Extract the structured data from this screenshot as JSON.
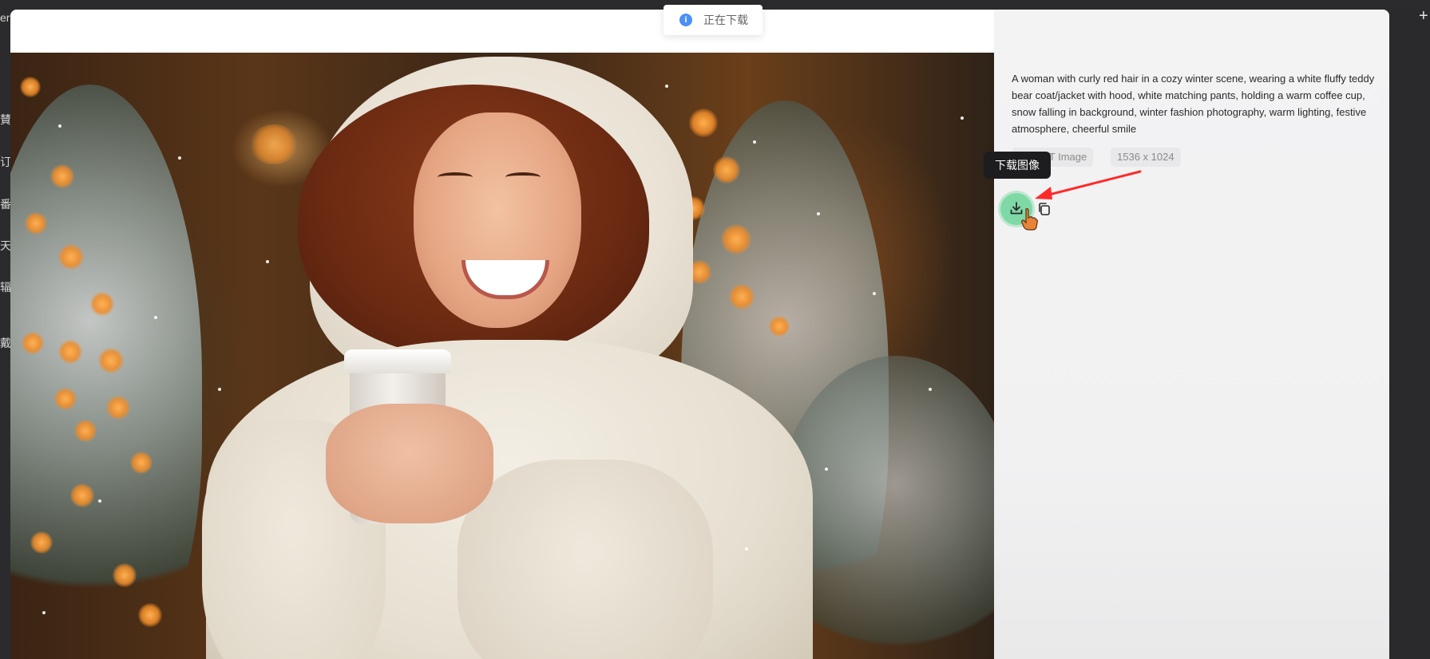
{
  "app": {
    "left_menu_fragments": [
      "er",
      "賛",
      "订",
      "番",
      "天",
      "辐",
      "戴"
    ]
  },
  "toast": {
    "message": "正在下载",
    "icon": "info-icon"
  },
  "image": {
    "alt_icon": "generated-image"
  },
  "info_panel": {
    "prompt": "A woman with curly red hair in a cozy winter scene, wearing a white fluffy teddy bear coat/jacket with hood, white matching pants, holding a warm coffee cup, snow falling in background, winter fashion photography, warm lighting, festive atmosphere, cheerful smile",
    "model_tag": "GPT Image",
    "size_tag": "1536 x 1024",
    "actions": {
      "download_tooltip": "下载图像",
      "download_icon": "download-icon",
      "copy_icon": "copy-icon"
    }
  },
  "colors": {
    "toast_info": "#4c8ff5",
    "download_highlight": "#7ed9a6",
    "arrow": "#ff2a2a",
    "tooltip_bg": "#1d1d1f"
  }
}
